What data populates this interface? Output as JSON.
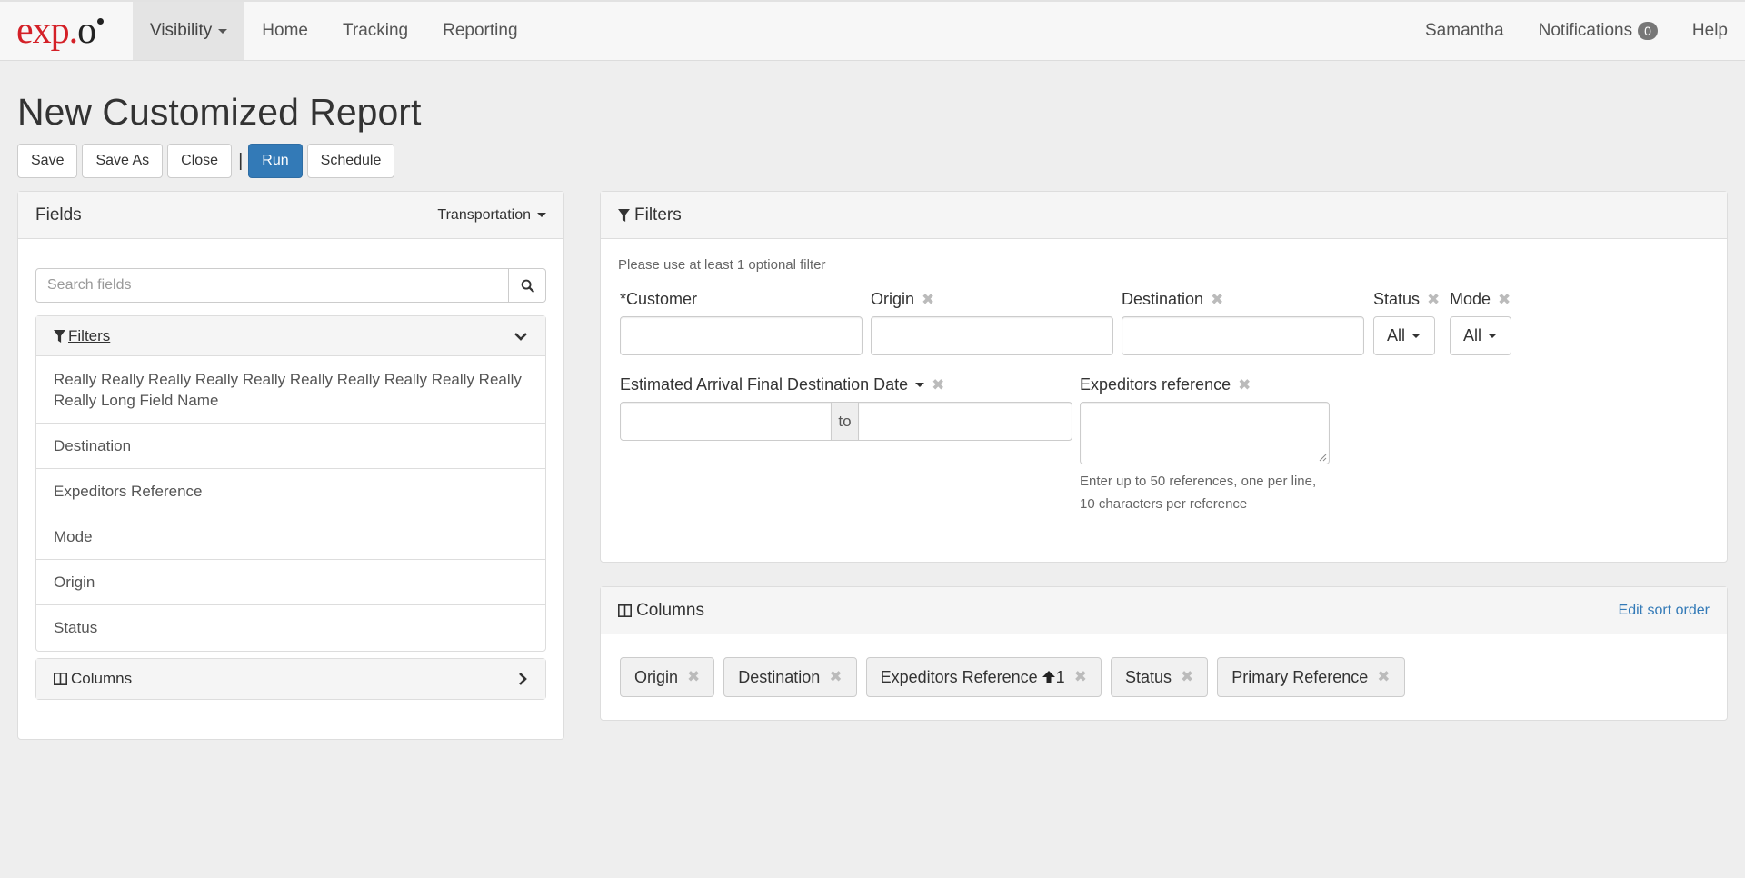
{
  "navbar": {
    "brand_main": "exp.",
    "brand_o": "o",
    "items": [
      {
        "label": "Visibility"
      },
      {
        "label": "Home"
      },
      {
        "label": "Tracking"
      },
      {
        "label": "Reporting"
      }
    ],
    "user": "Samantha",
    "notifications_label": "Notifications",
    "notifications_count": "0",
    "help": "Help"
  },
  "page": {
    "title": "New Customized Report"
  },
  "toolbar": {
    "save": "Save",
    "save_as": "Save As",
    "close": "Close",
    "separator": "|",
    "run": "Run",
    "schedule": "Schedule"
  },
  "fields_panel": {
    "title": "Fields",
    "category": "Transportation",
    "search_placeholder": "Search fields",
    "filters_title": "Filters",
    "filter_items": [
      "Really Really Really Really Really Really Really Really Really Really Really Long Field Name",
      "Destination",
      "Expeditors Reference",
      "Mode",
      "Origin",
      "Status"
    ],
    "columns_title": "Columns"
  },
  "filters_panel": {
    "title": "Filters",
    "hint": "Please use at least 1 optional filter",
    "customer_label": "*Customer",
    "origin_label": "Origin",
    "destination_label": "Destination",
    "status_label": "Status",
    "status_value": "All",
    "mode_label": "Mode",
    "mode_value": "All",
    "eta_label": "Estimated Arrival Final Destination Date",
    "to_label": "to",
    "ref_label": "Expeditors reference",
    "ref_help_line1": "Enter up to 50 references, one per line,",
    "ref_help_line2": "10 characters per reference"
  },
  "columns_panel": {
    "title": "Columns",
    "edit_sort": "Edit sort order",
    "chips": [
      {
        "label": "Origin",
        "sort": ""
      },
      {
        "label": "Destination",
        "sort": ""
      },
      {
        "label": "Expeditors Reference",
        "sort": "1"
      },
      {
        "label": "Status",
        "sort": ""
      },
      {
        "label": "Primary Reference",
        "sort": ""
      }
    ]
  },
  "colors": {
    "brand_red": "#d42027",
    "primary_blue": "#337ab7",
    "link_blue": "#337ab7"
  }
}
